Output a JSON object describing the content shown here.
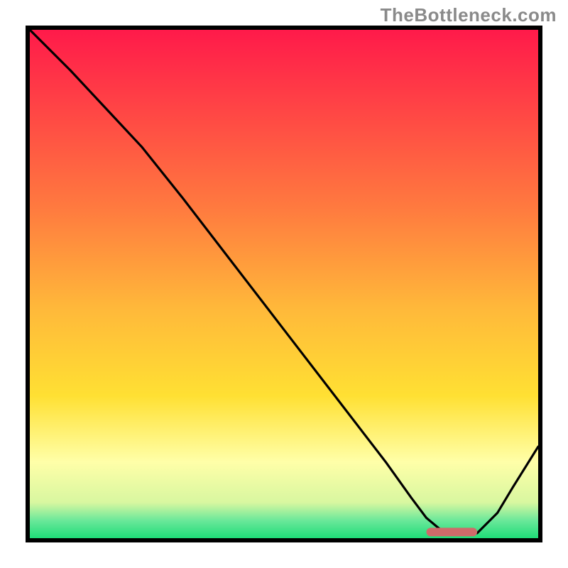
{
  "watermark": "TheBottleneck.com",
  "colors": {
    "frame_border": "#000000",
    "curve_stroke": "#000000",
    "marker_fill": "#cf6a6a",
    "gradient_top": "#ff1a4a",
    "gradient_mid1": "#ff944d",
    "gradient_mid2": "#ffe033",
    "gradient_pale": "#ffffa8",
    "gradient_green": "#1edc78"
  },
  "chart_data": {
    "type": "line",
    "title": "",
    "xlabel": "",
    "ylabel": "",
    "xlim": [
      0,
      100
    ],
    "ylim": [
      0,
      100
    ],
    "x": [
      0,
      8,
      15,
      22,
      26,
      30,
      40,
      50,
      60,
      70,
      75,
      78,
      81,
      84,
      88,
      92,
      95,
      100
    ],
    "values": [
      100,
      92,
      84.5,
      77,
      72,
      67,
      54,
      41,
      28,
      15,
      8,
      4,
      1.5,
      1,
      1,
      5,
      10,
      18
    ],
    "marker": {
      "x_start": 78,
      "x_end": 88,
      "y": 1.2
    },
    "background_gradient_stops": [
      {
        "offset": 0.0,
        "color": "#ff1a4a"
      },
      {
        "offset": 0.35,
        "color": "#ff7a3f"
      },
      {
        "offset": 0.55,
        "color": "#ffb93a"
      },
      {
        "offset": 0.72,
        "color": "#ffe033"
      },
      {
        "offset": 0.85,
        "color": "#ffffa8"
      },
      {
        "offset": 0.93,
        "color": "#d8f7a0"
      },
      {
        "offset": 0.965,
        "color": "#6be89a"
      },
      {
        "offset": 1.0,
        "color": "#1edc78"
      }
    ]
  }
}
